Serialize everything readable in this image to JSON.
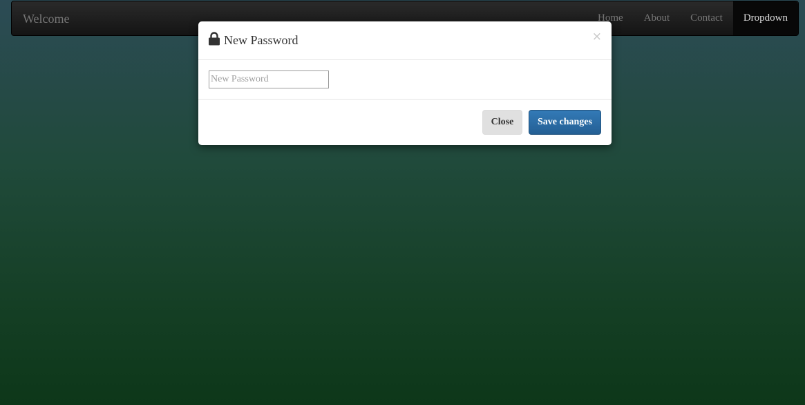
{
  "navbar": {
    "brand": "Welcome",
    "items": [
      {
        "label": "Home"
      },
      {
        "label": "About"
      },
      {
        "label": "Contact"
      },
      {
        "label": "Dropdown",
        "active": true
      }
    ]
  },
  "modal": {
    "icon": "lock-icon",
    "title": "New Password",
    "close_symbol": "×",
    "password_field": {
      "placeholder": "New Password",
      "value": ""
    },
    "buttons": {
      "close_label": "Close",
      "save_label": "Save changes"
    }
  },
  "colors": {
    "primary_button": "#337ab7",
    "navbar_bg": "#222222",
    "background_top": "#2c4b55",
    "background_bottom": "#0d3719"
  }
}
